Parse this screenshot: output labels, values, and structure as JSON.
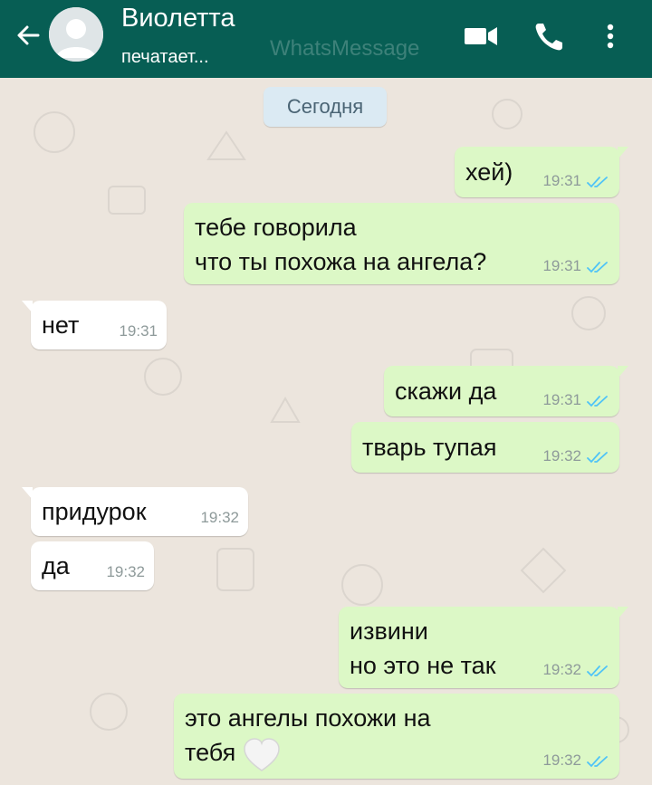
{
  "header": {
    "contact_name": "Виолетта",
    "status": "печатает...",
    "watermark": "WhatsMessage",
    "icons": {
      "back": "arrow-left-icon",
      "video": "video-call-icon",
      "call": "phone-icon",
      "menu": "more-vertical-icon"
    }
  },
  "chat": {
    "date_label": "Сегодня",
    "messages": [
      {
        "dir": "out",
        "text": "хей)",
        "time": "19:31",
        "read": true
      },
      {
        "dir": "out",
        "text": "тебе говорила\nчто ты похожа на ангела?",
        "time": "19:31",
        "read": true
      },
      {
        "dir": "in",
        "text": "нет",
        "time": "19:31"
      },
      {
        "dir": "out",
        "text": "скажи да",
        "time": "19:31",
        "read": true
      },
      {
        "dir": "out",
        "text": "тварь тупая",
        "time": "19:32",
        "read": true
      },
      {
        "dir": "in",
        "text": "придурок",
        "time": "19:32"
      },
      {
        "dir": "in",
        "text": "да",
        "time": "19:32"
      },
      {
        "dir": "out",
        "text": "извини\nно это не так",
        "time": "19:32",
        "read": true
      },
      {
        "dir": "out",
        "text": "это ангелы похожи на\nтебя",
        "time": "19:32",
        "read": true,
        "emoji": "white-heart-icon"
      }
    ]
  },
  "colors": {
    "header_bg": "#075e54",
    "chat_bg": "#ece5dd",
    "outgoing_bubble": "#dcf8c6",
    "incoming_bubble": "#ffffff",
    "read_ticks": "#4fc3f7",
    "date_chip": "#dbeaf3"
  }
}
